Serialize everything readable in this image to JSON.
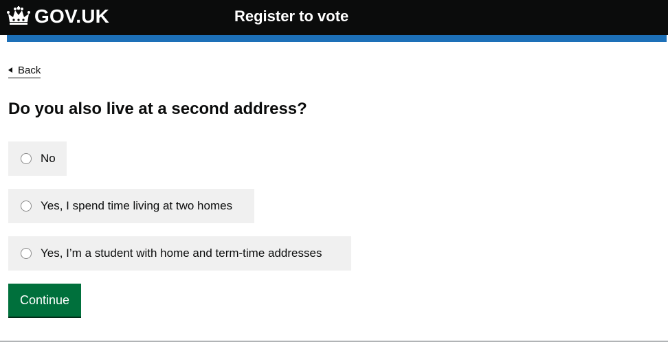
{
  "header": {
    "logo_text": "GOV.UK",
    "service_name": "Register to vote",
    "stripe_color": "#1d70b8"
  },
  "back_link": {
    "label": "Back"
  },
  "question": {
    "title": "Do you also live at a second address?",
    "options": [
      {
        "label": "No",
        "selected": false
      },
      {
        "label": "Yes, I spend time living at two homes",
        "selected": false
      },
      {
        "label": "Yes, I’m a student with home and term-time addresses",
        "selected": false
      }
    ]
  },
  "actions": {
    "continue_label": "Continue",
    "continue_color": "#00703c"
  }
}
